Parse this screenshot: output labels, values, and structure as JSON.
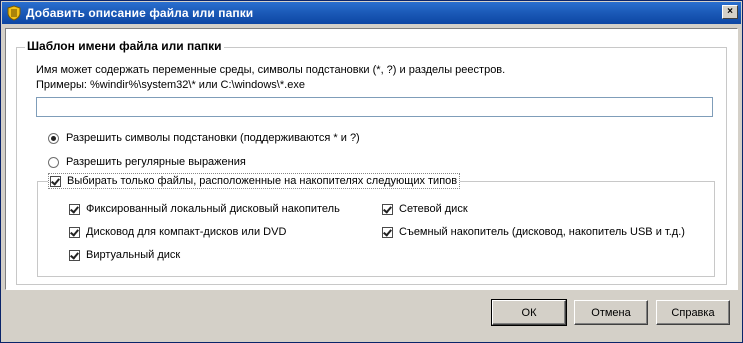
{
  "window": {
    "title": "Добавить описание файла или папки",
    "close_label": "×"
  },
  "group": {
    "title": "Шаблон имени файла или папки",
    "description_line1": "Имя может содержать переменные среды, символы подстановки (*, ?) и разделы реестров.",
    "description_line2": "Примеры:  %windir%\\system32\\* или C:\\windows\\*.exe",
    "input_value": ""
  },
  "options": {
    "radio_wildcards": {
      "label": "Разрешить символы подстановки (поддерживаются * и ?)",
      "checked": true
    },
    "radio_regex": {
      "label": "Разрешить регулярные выражения",
      "checked": false
    },
    "drive_filter": {
      "label": "Выбирать только файлы, расположенные на накопителях следующих типов",
      "checked": true
    }
  },
  "drive_types": {
    "fixed": {
      "label": "Фиксированный локальный дисковый накопитель",
      "checked": true
    },
    "cdrom": {
      "label": "Дисковод для компакт-дисков или DVD",
      "checked": true
    },
    "virtual": {
      "label": "Виртуальный диск",
      "checked": true
    },
    "network": {
      "label": "Сетевой диск",
      "checked": true
    },
    "removable": {
      "label": "Съемный накопитель (дисковод, накопитель USB и т.д.)",
      "checked": true
    }
  },
  "buttons": {
    "ok": "ОК",
    "cancel": "Отмена",
    "help": "Справка"
  }
}
